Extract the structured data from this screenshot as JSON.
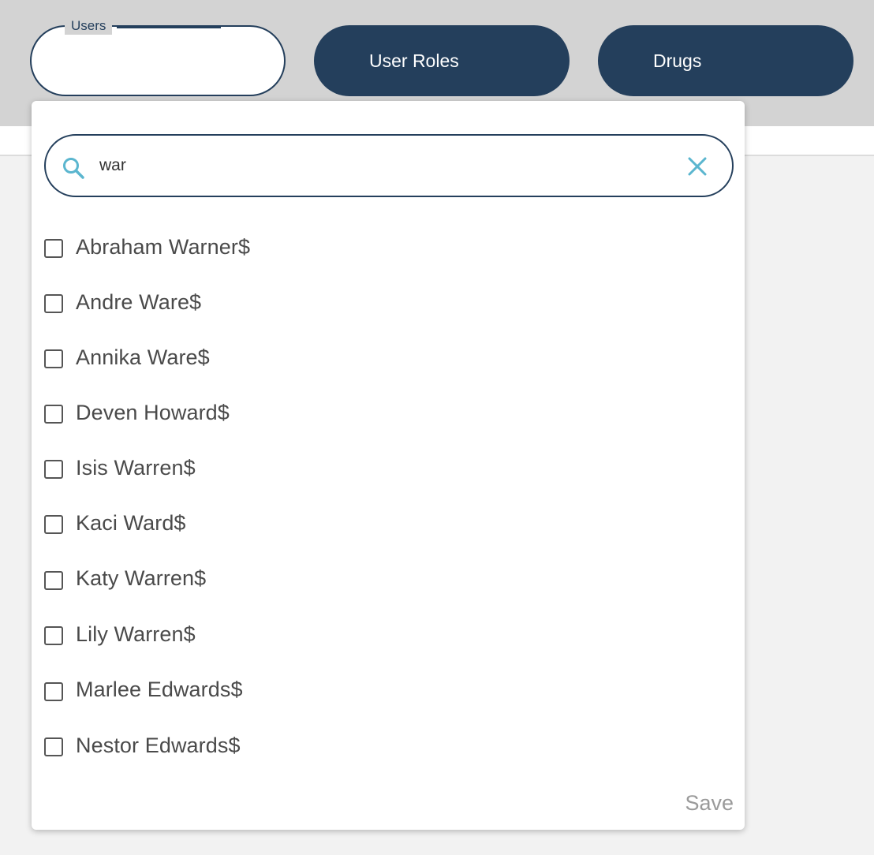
{
  "header": {
    "users_field_label": "Users",
    "buttons": {
      "user_roles": "User Roles",
      "drugs": "Drugs"
    }
  },
  "dropdown": {
    "search": {
      "value": "war",
      "search_icon": "search-icon",
      "clear_icon": "close-icon"
    },
    "options": [
      {
        "label": "Abraham Warner$",
        "checked": false
      },
      {
        "label": "Andre Ware$",
        "checked": false
      },
      {
        "label": "Annika Ware$",
        "checked": false
      },
      {
        "label": "Deven Howard$",
        "checked": false
      },
      {
        "label": "Isis Warren$",
        "checked": false
      },
      {
        "label": "Kaci Ward$",
        "checked": false
      },
      {
        "label": "Katy Warren$",
        "checked": false
      },
      {
        "label": "Lily Warren$",
        "checked": false
      },
      {
        "label": "Marlee Edwards$",
        "checked": false
      },
      {
        "label": "Nestor Edwards$",
        "checked": false
      }
    ],
    "save_label": "Save"
  },
  "colors": {
    "navy": "#243f5c",
    "accent": "#5bb6cf",
    "header_bg": "#d3d3d3",
    "page_bg": "#f2f2f2",
    "save_disabled": "#9a9a9a"
  }
}
